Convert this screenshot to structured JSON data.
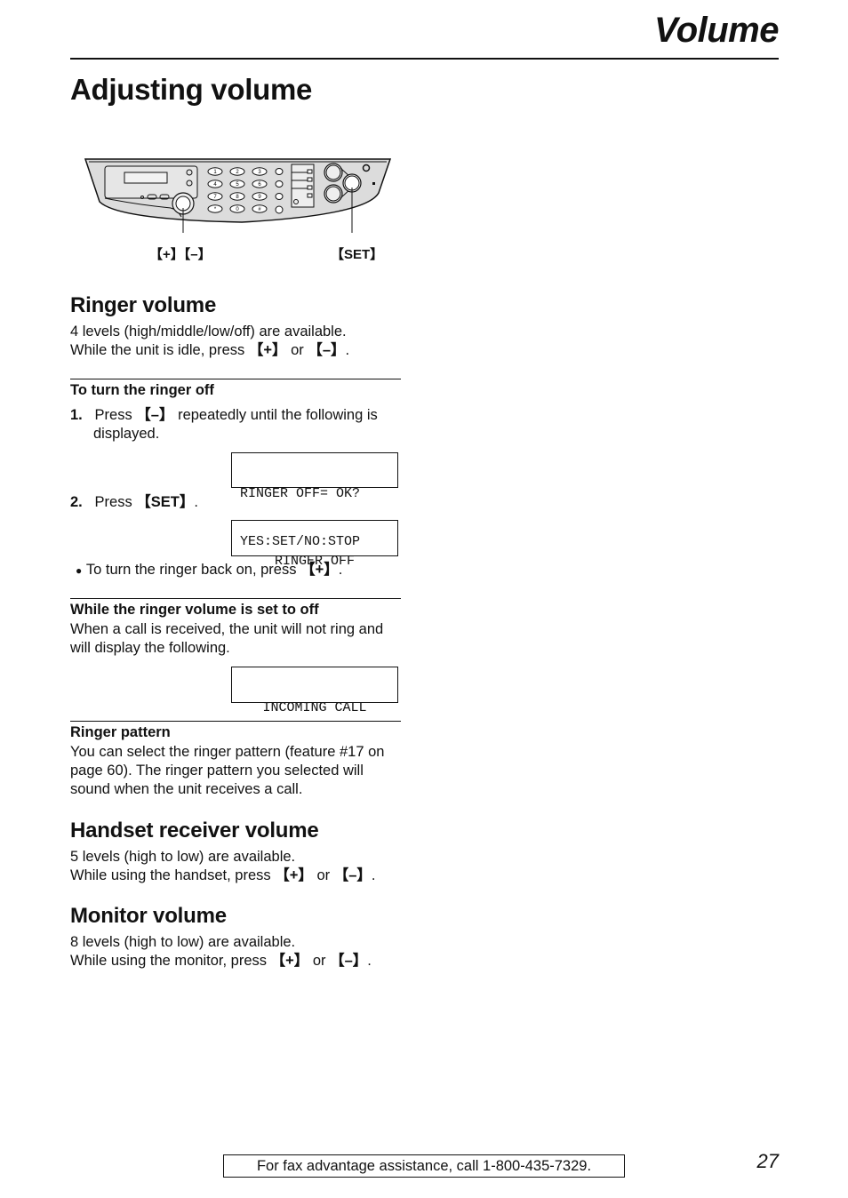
{
  "header": {
    "section_title": "Volume"
  },
  "page_title": "Adjusting volume",
  "illustration": {
    "callout_plus_minus": "【+】【–】",
    "callout_set": "【SET】",
    "keypad": [
      "1",
      "2",
      "3",
      "4",
      "5",
      "6",
      "7",
      "8",
      "9",
      "*",
      "0",
      "#"
    ]
  },
  "ringer_volume": {
    "heading": "Ringer volume",
    "line1": "4 levels (high/middle/low/off) are available.",
    "line2_pre": "While the unit is idle, press ",
    "key_plus": "【+】",
    "or": " or ",
    "key_minus": "【–】",
    "end": "."
  },
  "turn_off": {
    "heading": "To turn the ringer off",
    "step1_num": "1.",
    "step1_pre": "Press ",
    "step1_key": "【–】",
    "step1_post": " repeatedly until the following is",
    "step1_line2": "displayed.",
    "display1_line1": "RINGER OFF= OK?",
    "display1_line2": "YES:SET/NO:STOP",
    "step2_num": "2.",
    "step2_pre": "Press ",
    "step2_key": "【SET】",
    "step2_post": ".",
    "display2_line1": "RINGER OFF",
    "bullet_pre": "To turn the ringer back on, press ",
    "bullet_key": "【+】",
    "bullet_post": "."
  },
  "while_off": {
    "heading": "While the ringer volume is set to off",
    "line1": "When a call is received, the unit will not ring and",
    "line2": "will display the following.",
    "display_line1": "INCOMING CALL"
  },
  "ringer_pattern": {
    "heading": "Ringer pattern",
    "line1": "You can select the ringer pattern (feature #17 on",
    "line2": "page 60). The ringer pattern you selected will",
    "line3": "sound when the unit receives a call."
  },
  "handset_volume": {
    "heading": "Handset receiver volume",
    "line1": "5 levels (high to low) are available.",
    "line2_pre": "While using the handset, press ",
    "key_plus": "【+】",
    "or": " or ",
    "key_minus": "【–】",
    "end": "."
  },
  "monitor_volume": {
    "heading": "Monitor volume",
    "line1": "8 levels (high to low) are available.",
    "line2_pre": "While using the monitor, press ",
    "key_plus": "【+】",
    "or": " or ",
    "key_minus": "【–】",
    "end": "."
  },
  "footer": {
    "assistance": "For fax advantage assistance, call 1-800-435-7329.",
    "page_number": "27"
  }
}
